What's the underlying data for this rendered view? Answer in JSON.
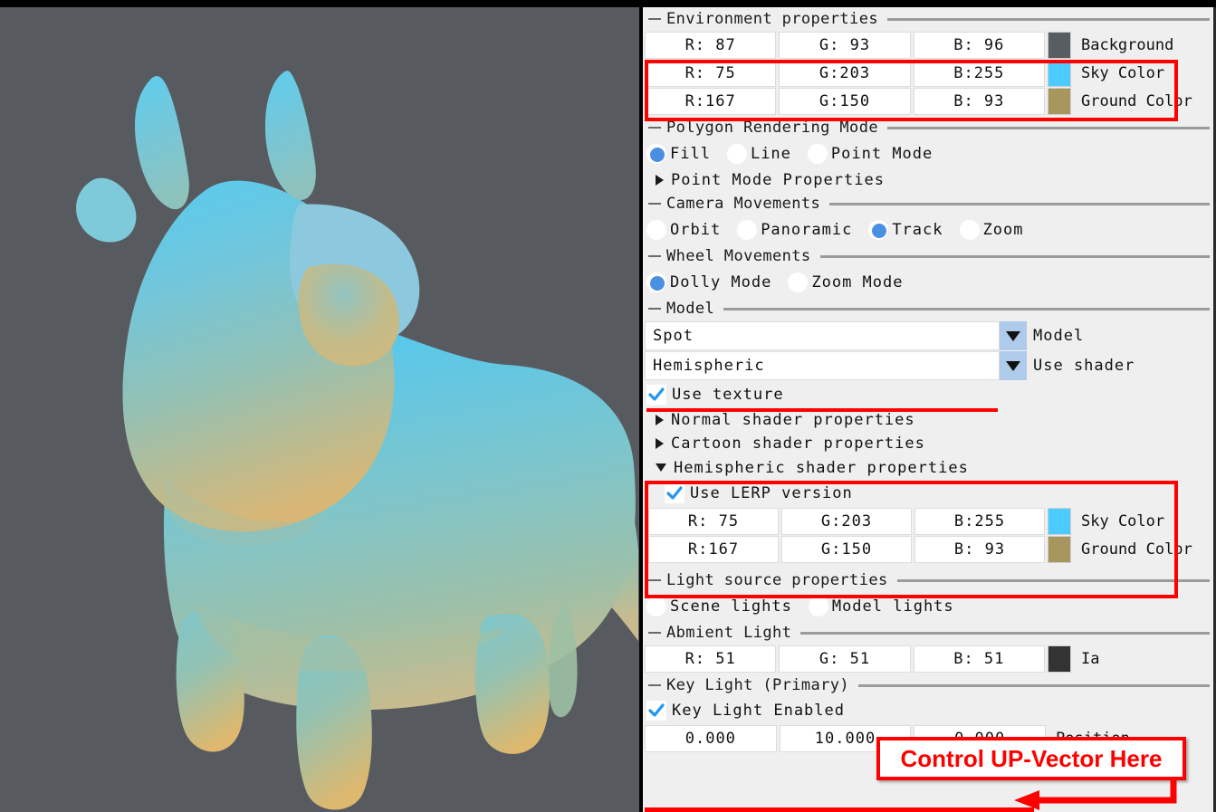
{
  "viewport": {
    "background_color": "#575B5F",
    "model_name": "Spot",
    "sky_color": "#4BCBFF",
    "ground_color": "#A7965D"
  },
  "panel": {
    "environment": {
      "title": "Environment properties",
      "rows": [
        {
          "r": "R: 87",
          "g": "G: 93",
          "b": "B: 96",
          "color": "#575D60",
          "label": "Background"
        },
        {
          "r": "R: 75",
          "g": "G:203",
          "b": "B:255",
          "color": "#4BCBFF",
          "label": "Sky Color"
        },
        {
          "r": "R:167",
          "g": "G:150",
          "b": "B: 93",
          "color": "#A7965D",
          "label": "Ground Color"
        }
      ]
    },
    "polygon_mode": {
      "title": "Polygon Rendering Mode",
      "options": [
        {
          "label": "Fill",
          "selected": true
        },
        {
          "label": "Line",
          "selected": false
        },
        {
          "label": "Point Mode",
          "selected": false
        }
      ],
      "expander": "Point Mode Properties"
    },
    "camera_movements": {
      "title": "Camera Movements",
      "options": [
        {
          "label": "Orbit",
          "selected": false
        },
        {
          "label": "Panoramic",
          "selected": false
        },
        {
          "label": "Track",
          "selected": true
        },
        {
          "label": "Zoom",
          "selected": false
        }
      ]
    },
    "wheel_movements": {
      "title": "Wheel Movements",
      "options": [
        {
          "label": "Dolly Mode",
          "selected": true
        },
        {
          "label": "Zoom Mode",
          "selected": false
        }
      ]
    },
    "model": {
      "title": "Model",
      "model_value": "Spot",
      "model_label": "Model",
      "shader_value": "Hemispheric",
      "shader_label": "Use shader",
      "use_texture": "Use texture",
      "use_texture_checked": true,
      "expanders": [
        "Normal shader properties",
        "Cartoon shader properties"
      ]
    },
    "hemispheric": {
      "title": "Hemispheric shader properties",
      "use_lerp": "Use LERP version",
      "use_lerp_checked": true,
      "rows": [
        {
          "r": "R: 75",
          "g": "G:203",
          "b": "B:255",
          "color": "#4BCBFF",
          "label": "Sky Color"
        },
        {
          "r": "R:167",
          "g": "G:150",
          "b": "B: 93",
          "color": "#A7965D",
          "label": "Ground Color"
        }
      ]
    },
    "light_source": {
      "title": "Light source properties",
      "options": [
        {
          "label": "Scene lights",
          "selected": false
        },
        {
          "label": "Model lights",
          "selected": false
        }
      ]
    },
    "ambient_light": {
      "title": "Abmient Light",
      "row": {
        "r": "R: 51",
        "g": "G: 51",
        "b": "B: 51",
        "color": "#333333",
        "label": "Ia"
      }
    },
    "key_light": {
      "title": "Key Light (Primary)",
      "enabled_label": "Key Light Enabled",
      "enabled_checked": true,
      "position": {
        "x": "0.000",
        "y": "10.000",
        "z": "0.000",
        "label": "Position"
      }
    }
  },
  "annotations": {
    "up_vector_note": "Control UP-Vector Here",
    "highlight_color": "#ff0000"
  }
}
